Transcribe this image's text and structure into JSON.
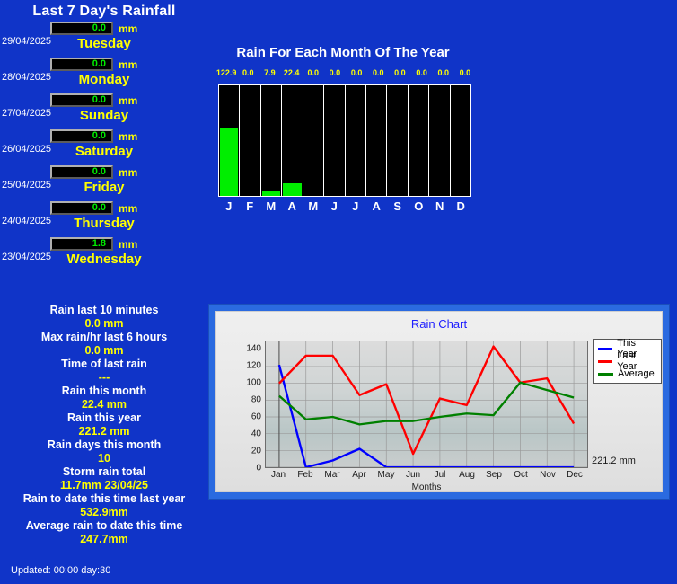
{
  "left": {
    "title": "Last 7 Day's Rainfall",
    "unit": "mm",
    "days": [
      {
        "date": "29/04/2025",
        "value": "0.0",
        "unit": "mm",
        "name": "Tuesday"
      },
      {
        "date": "28/04/2025",
        "value": "0.0",
        "unit": "mm",
        "name": "Monday"
      },
      {
        "date": "27/04/2025",
        "value": "0.0",
        "unit": "mm",
        "name": "Sunday"
      },
      {
        "date": "26/04/2025",
        "value": "0.0",
        "unit": "mm",
        "name": "Saturday"
      },
      {
        "date": "25/04/2025",
        "value": "0.0",
        "unit": "mm",
        "name": "Friday"
      },
      {
        "date": "24/04/2025",
        "value": "0.0",
        "unit": "mm",
        "name": "Thursday"
      },
      {
        "date": "23/04/2025",
        "value": "1.8",
        "unit": "mm",
        "name": "Wednesday"
      }
    ],
    "stats": [
      {
        "label": "Rain last 10 minutes",
        "value": "0.0 mm"
      },
      {
        "label": "Max rain/hr last 6 hours",
        "value": "0.0 mm"
      },
      {
        "label": "Time of last rain",
        "value": "---"
      },
      {
        "label": "Rain this month",
        "value": "22.4 mm"
      },
      {
        "label": "Rain this year",
        "value": "221.2 mm"
      },
      {
        "label": "Rain days this month",
        "value": "10"
      },
      {
        "label": "Storm rain total",
        "value": "11.7mm 23/04/25"
      },
      {
        "label": "Rain to date this time last year",
        "value": "532.9mm"
      },
      {
        "label": "Average rain to date this time",
        "value": "247.7mm"
      }
    ],
    "updated": "Updated: 00:00 day:30"
  },
  "month_chart": {
    "title": "Rain For Each Month Of The Year"
  },
  "rain_chart_panel": {
    "title": "Rain Chart",
    "annotation": "221.2 mm"
  },
  "colors": {
    "page_background": "#1034c8",
    "title_white": "#ffffff",
    "value_yellow": "#ffff00",
    "lcd_green": "#00ee00",
    "lcd_background": "#000000",
    "this_year": "#0000ff",
    "last_year": "#ff0000",
    "average": "#008000",
    "chart_title_blue": "#2020ff"
  },
  "chart_data": [
    {
      "type": "bar",
      "title": "Rain For Each Month Of The Year",
      "categories": [
        "J",
        "F",
        "M",
        "A",
        "M",
        "J",
        "J",
        "A",
        "S",
        "O",
        "N",
        "D"
      ],
      "values": [
        122.9,
        0.0,
        7.9,
        22.4,
        0.0,
        0.0,
        0.0,
        0.0,
        0.0,
        0.0,
        0.0,
        0.0
      ],
      "value_labels": [
        "122.9",
        "0.0",
        "7.9",
        "22.4",
        "0.0",
        "0.0",
        "0.0",
        "0.0",
        "0.0",
        "0.0",
        "0.0",
        "0.0"
      ],
      "xlabel": "",
      "ylabel": "",
      "ylim": [
        0,
        200
      ],
      "grid": false,
      "legend": "none",
      "bar_color": "#00ee00",
      "plot_background": "#000000"
    },
    {
      "type": "line",
      "title": "Rain Chart",
      "categories": [
        "Jan",
        "Feb",
        "Mar",
        "Apr",
        "May",
        "Jun",
        "Jul",
        "Aug",
        "Sep",
        "Oct",
        "Nov",
        "Dec"
      ],
      "series": [
        {
          "name": "This Year",
          "color": "#0000ff",
          "values": [
            122,
            0,
            8,
            22,
            0,
            0,
            0,
            0,
            0,
            0,
            0,
            0
          ]
        },
        {
          "name": "Last Year",
          "color": "#ff0000",
          "values": [
            100,
            133,
            133,
            86,
            99,
            16,
            82,
            74,
            144,
            101,
            106,
            52
          ]
        },
        {
          "name": "Average",
          "color": "#008000",
          "values": [
            85,
            57,
            60,
            51,
            55,
            55,
            60,
            64,
            62,
            101,
            92,
            83
          ]
        }
      ],
      "xlabel": "Months",
      "ylabel": "",
      "ylim": [
        0,
        150
      ],
      "yticks": [
        0,
        20,
        40,
        60,
        80,
        100,
        120,
        140
      ],
      "grid": true,
      "legend": "top-right",
      "annotation": "221.2 mm"
    }
  ]
}
